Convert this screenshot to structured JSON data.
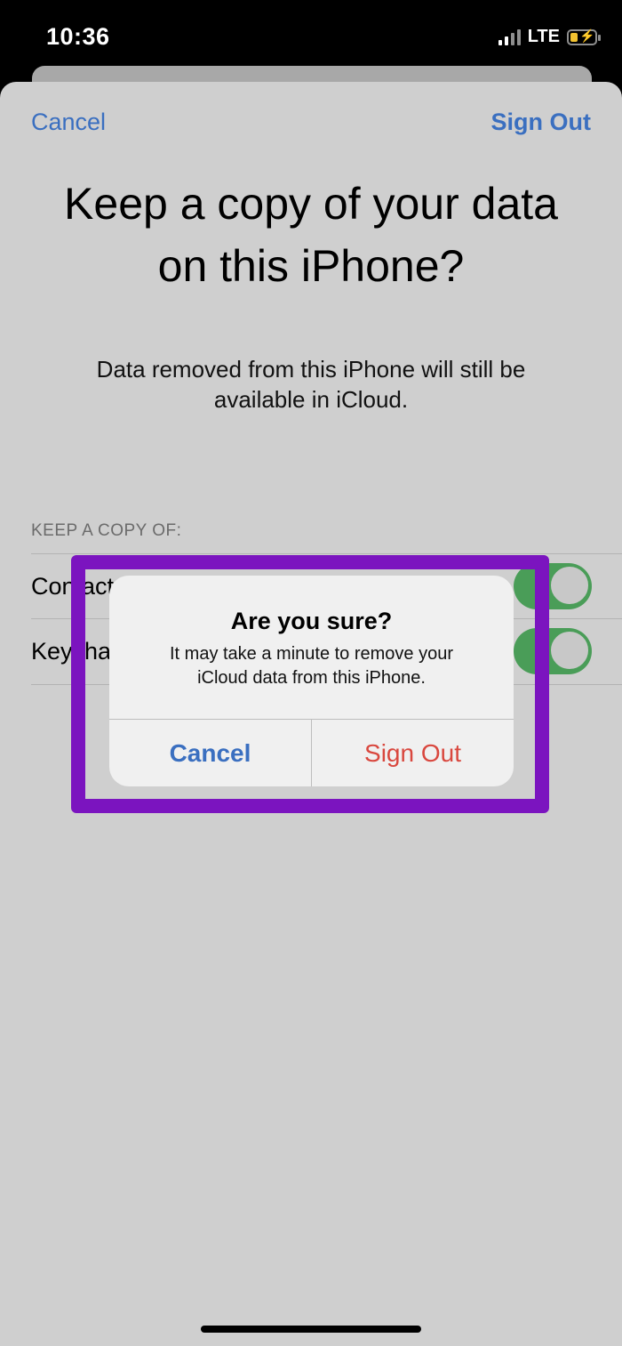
{
  "status_bar": {
    "time": "10:36",
    "network": "LTE"
  },
  "sheet": {
    "nav_cancel": "Cancel",
    "nav_sign_out": "Sign Out",
    "title_line1": "Keep a copy of your data",
    "title_line2": "on this iPhone?",
    "subtitle_line1": "Data removed from this iPhone will still be",
    "subtitle_line2": "available in iCloud.",
    "section_header": "KEEP A COPY OF:",
    "rows": [
      {
        "label": "Contacts",
        "on": true
      },
      {
        "label": "Keychain",
        "on": true
      }
    ]
  },
  "alert": {
    "title": "Are you sure?",
    "message_line1": "It may take a minute to remove your",
    "message_line2": "iCloud data from this iPhone.",
    "cancel_label": "Cancel",
    "sign_out_label": "Sign Out"
  },
  "colors": {
    "accent_blue": "#3a6fc0",
    "destructive_red": "#d9473e",
    "toggle_green": "#4a9d58",
    "highlight_purple": "#7b14bf"
  }
}
